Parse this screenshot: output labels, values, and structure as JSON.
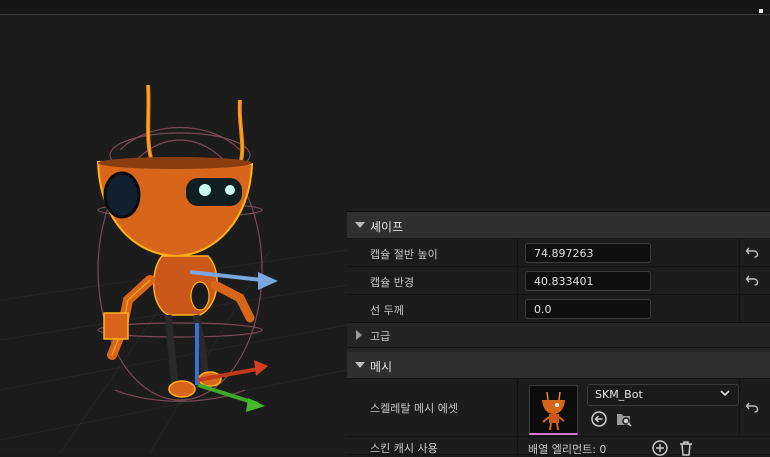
{
  "sections": {
    "shape": {
      "title": "셰이프",
      "rows": [
        {
          "label": "캡슐 절반 높이",
          "value": "74.897263"
        },
        {
          "label": "캡슐 반경",
          "value": "40.833401"
        },
        {
          "label": "선 두께",
          "value": "0.0"
        }
      ],
      "advanced_label": "고급"
    },
    "mesh": {
      "title": "메시",
      "skeletal_mesh_label": "스켈레탈 메시 에셋",
      "asset_name": "SKM_Bot",
      "skin_cache_label": "스킨 캐시 사용",
      "array_elements": "배열 엘리먼트: 0"
    }
  },
  "icons": [
    "reset-arrow-icon",
    "chevron-down-icon",
    "browse-back-icon",
    "find-in-browser-icon",
    "add-element-icon",
    "delete-icon"
  ],
  "colors": {
    "accent_orange": "#f08a1c",
    "selection_outline": "#ffb21a",
    "thumbnail_underline": "#d078d0"
  }
}
